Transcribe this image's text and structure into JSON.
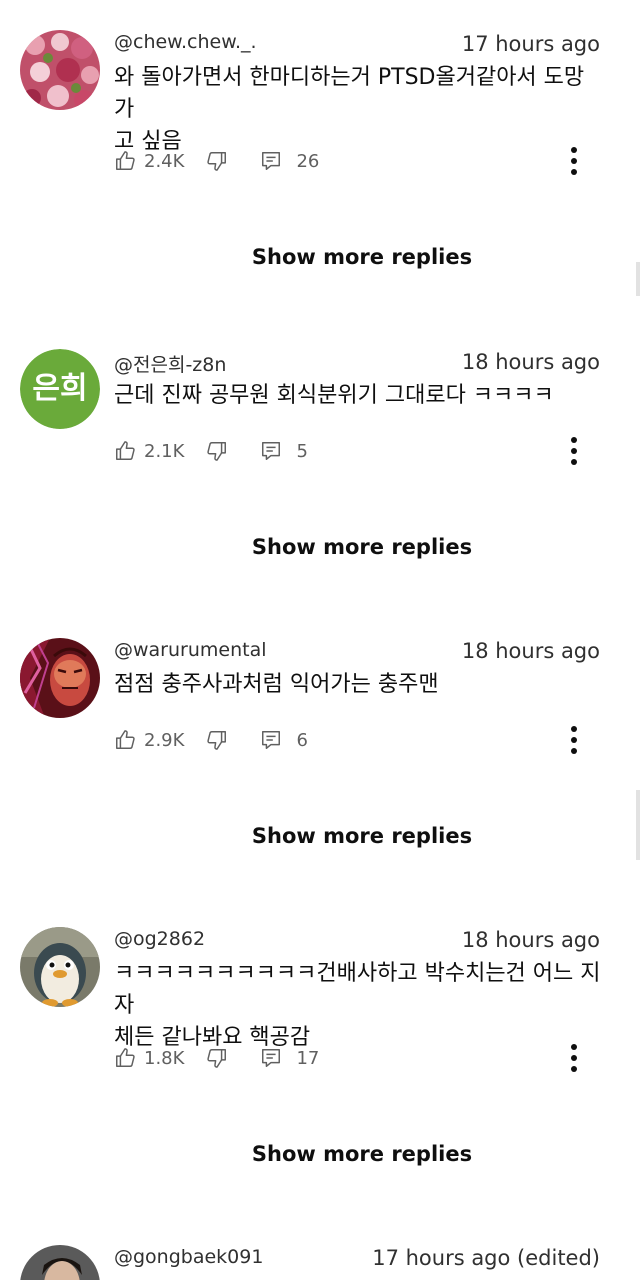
{
  "comments": [
    {
      "handle": "@chew.chew._.",
      "time": "17 hours ago",
      "text_lines": [
        "와 돌아가면서 한마디하는거 PTSD올거같아서 도망가",
        "고 싶음"
      ],
      "likes": "2.4K",
      "replies": "26",
      "show_more": "Show more replies",
      "avatar_icon": "flower-avatar"
    },
    {
      "handle": "@전은희-z8n",
      "time": "18 hours ago",
      "text_lines": [
        "근데 진짜 공무원 회식분위기 그대로다 ㅋㅋㅋㅋ"
      ],
      "likes": "2.1K",
      "replies": "5",
      "show_more": "Show more replies",
      "avatar_text": "은희",
      "avatar_color": "#6aaa3a"
    },
    {
      "handle": "@warurumental",
      "time": "18 hours ago",
      "text_lines": [
        "점점 충주사과처럼 익어가는 충주맨"
      ],
      "likes": "2.9K",
      "replies": "6",
      "show_more": "Show more replies",
      "avatar_icon": "anime-character-avatar"
    },
    {
      "handle": "@og2862",
      "time": "18 hours ago",
      "text_lines": [
        "ㅋㅋㅋㅋㅋㅋㅋㅋㅋㅋ건배사하고 박수치는건 어느 지자",
        "체든 같나봐요 핵공감"
      ],
      "likes": "1.8K",
      "replies": "17",
      "show_more": "Show more replies",
      "avatar_icon": "penguin-avatar"
    },
    {
      "handle": "@gongbaek091",
      "time": "17 hours ago (edited)",
      "avatar_icon": "person-avatar"
    }
  ],
  "colors": {
    "text": "#0f0f0f",
    "secondary": "#606060",
    "background": "#ffffff"
  }
}
